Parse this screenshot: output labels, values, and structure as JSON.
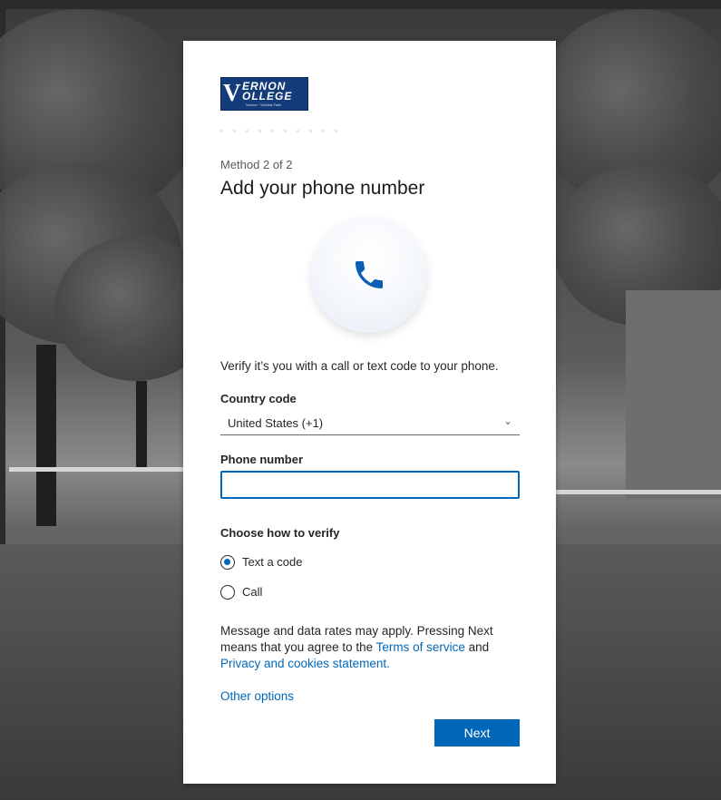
{
  "logo": {
    "line1": "ERNON",
    "line2": "OLLEGE",
    "monogram": "V",
    "tagline": "Vernon · Wichita Falls"
  },
  "method_step": "Method 2 of 2",
  "title": "Add your phone number",
  "phone_icon": "phone-icon",
  "description": "Verify it’s you with a call or text code to your phone.",
  "country": {
    "label": "Country code",
    "selected": "United States (+1)"
  },
  "phone": {
    "label": "Phone number",
    "value": ""
  },
  "verify": {
    "label": "Choose how to verify",
    "options": [
      {
        "label": "Text a code",
        "selected": true
      },
      {
        "label": "Call",
        "selected": false
      }
    ]
  },
  "legal": {
    "text1": "Message and data rates may apply. Pressing Next means that you agree to the ",
    "terms_link": "Terms of service",
    "text2": " and ",
    "privacy_link": "Privacy and cookies statement."
  },
  "other_options": "Other options",
  "next_button": "Next",
  "colors": {
    "accent": "#0067b8",
    "logo_bg": "#143b7a"
  }
}
